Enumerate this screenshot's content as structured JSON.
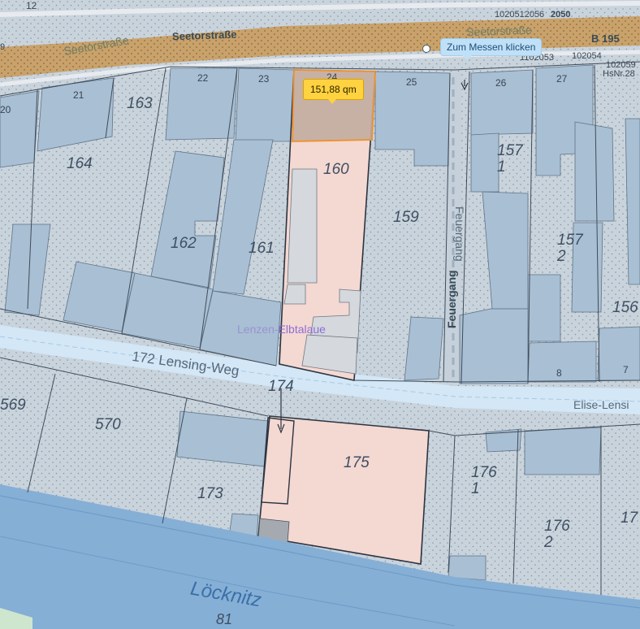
{
  "map": {
    "streets": {
      "seetor_main": "Seetorstraße",
      "seetor_left": "Seetorstraße",
      "seetor_right": "Seetorstraße",
      "b195": "B 195",
      "lensing": "172 Lensing-Weg",
      "elise": "Elise-Lensi",
      "feuergang_v1": "Feuergang",
      "feuergang_v2": "Feuergang"
    },
    "parcels": [
      "163",
      "164",
      "162",
      "161",
      "160",
      "159",
      "174",
      "175",
      "173",
      "570",
      "569",
      "157\n1",
      "157\n2",
      "156",
      "176\n1",
      "176\n2",
      "17"
    ],
    "house_numbers": [
      "12",
      "20",
      "21",
      "22",
      "23",
      "24",
      "25",
      "26",
      "27",
      "8",
      "7",
      "HsNr.28"
    ],
    "ids": [
      "1020512056",
      "2050",
      "1102053",
      "102054",
      "102059"
    ],
    "water": {
      "name": "Löcknitz",
      "number": "81"
    },
    "area": {
      "part1": "Lenzen-",
      "part2": "Elbtalaue"
    },
    "edge_number": "9"
  },
  "tooltip": {
    "text": "Zum Messen klicken"
  },
  "measurement": {
    "value": "151,88 qm"
  },
  "colors": {
    "base": "#c9d3dc",
    "building": "#a9bfd3",
    "selected": "#f4d8d2",
    "measured": "#c2aea0",
    "road": "#c9a26b",
    "water": "#86afd6"
  }
}
